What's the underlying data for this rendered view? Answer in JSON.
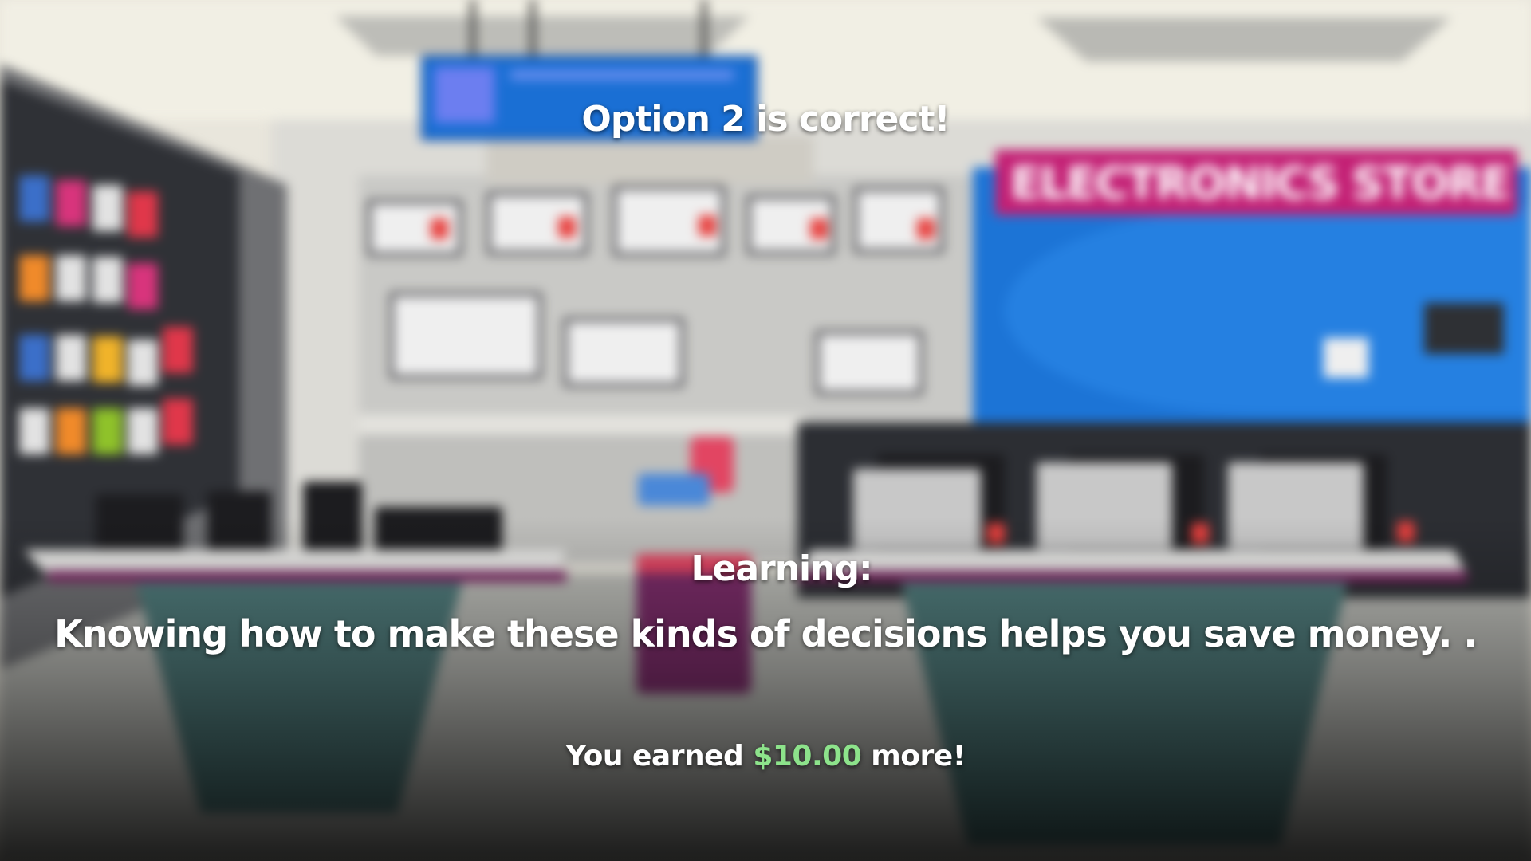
{
  "scene": {
    "store_sign": "ELECTRONICS STORE"
  },
  "result": {
    "title": "Option 2 is correct!"
  },
  "learning": {
    "heading": "Learning:",
    "body": "Knowing how to make these kinds of decisions helps you save money. ."
  },
  "reward": {
    "prefix": "You earned",
    "amount": "$10.00",
    "suffix": "more!"
  },
  "colors": {
    "reward_amount": "#8de38b",
    "text": "#ffffff",
    "sign_bg": "#c31f74",
    "store_wall": "#1c74d6"
  }
}
